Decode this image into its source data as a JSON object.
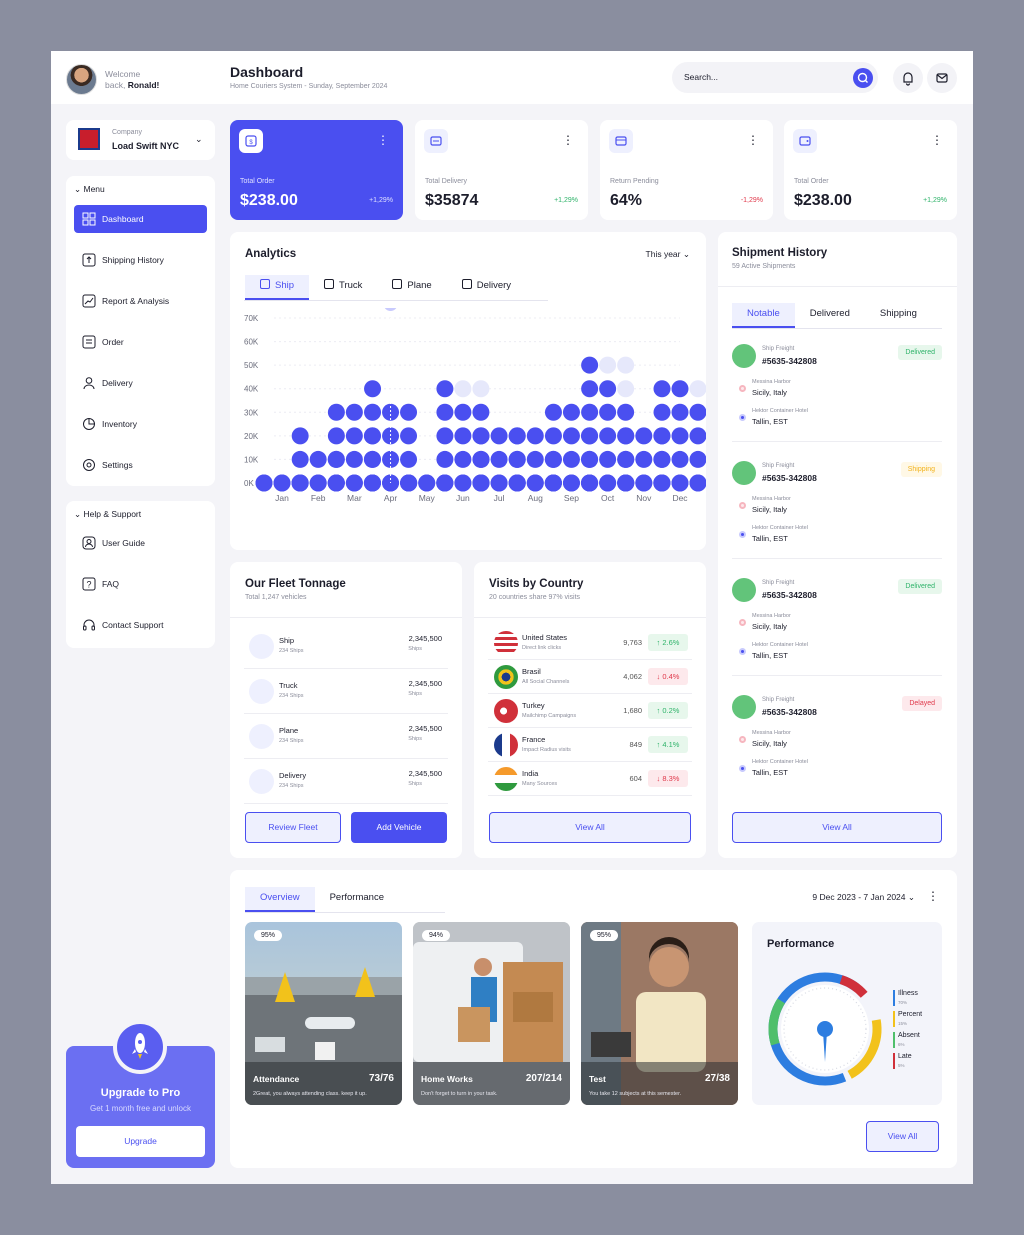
{
  "header": {
    "welcome": "Welcome",
    "welcome_back": "back,",
    "user_name": "Ronald!",
    "title": "Dashboard",
    "subtitle": "Home Couriers System - Sunday, September 2024",
    "search_placeholder": "Search..."
  },
  "company": {
    "label": "Company",
    "name": "Load Swift NYC"
  },
  "menu": {
    "section": "Menu",
    "items": [
      {
        "label": "Dashboard",
        "icon": "grid-icon"
      },
      {
        "label": "Shipping History",
        "icon": "upload-box-icon"
      },
      {
        "label": "Report & Analysis",
        "icon": "chart-icon"
      },
      {
        "label": "Order",
        "icon": "order-icon"
      },
      {
        "label": "Delivery",
        "icon": "user-icon"
      },
      {
        "label": "Inventory",
        "icon": "pie-icon"
      },
      {
        "label": "Settings",
        "icon": "gear-icon"
      }
    ]
  },
  "help": {
    "section": "Help & Support",
    "items": [
      {
        "label": "User Guide",
        "icon": "user-guide-icon"
      },
      {
        "label": "FAQ",
        "icon": "question-icon"
      },
      {
        "label": "Contact Support",
        "icon": "headset-icon"
      }
    ]
  },
  "upgrade": {
    "title": "Upgrade to Pro",
    "subtitle": "Get 1 month free and unlock",
    "button": "Upgrade"
  },
  "stats": [
    {
      "label": "Total Order",
      "value": "$238.00",
      "change": "+1,29%",
      "dir": "up"
    },
    {
      "label": "Total Delivery",
      "value": "$35874",
      "change": "+1,29%",
      "dir": "up"
    },
    {
      "label": "Return Pending",
      "value": "64%",
      "change": "-1,29%",
      "dir": "down"
    },
    {
      "label": "Total Order",
      "value": "$238.00",
      "change": "+1,29%",
      "dir": "up"
    }
  ],
  "analytics": {
    "title": "Analytics",
    "period": "This year",
    "tabs": [
      "Ship",
      "Truck",
      "Plane",
      "Delivery"
    ]
  },
  "chart_data": {
    "type": "bar",
    "title": "Analytics",
    "categories": [
      "Jan",
      "Feb",
      "Mar",
      "Apr",
      "May",
      "Jun",
      "Jul",
      "Aug",
      "Sep",
      "Oct",
      "Nov",
      "Dec"
    ],
    "yticks": [
      "0K",
      "10K",
      "20K",
      "30K",
      "40K",
      "50K",
      "60K",
      "70K"
    ],
    "ylim": [
      0,
      70
    ],
    "series": [
      {
        "values": [
          0,
          20,
          30,
          70,
          0,
          40,
          20,
          20,
          30,
          50,
          20,
          40
        ]
      },
      {
        "values": [
          0,
          10,
          30,
          30,
          0,
          30,
          20,
          20,
          30,
          40,
          30,
          40
        ]
      },
      {
        "values": [
          0,
          10,
          20,
          30,
          0,
          30,
          20,
          10,
          20,
          30,
          20,
          30
        ]
      }
    ],
    "background_levels": [
      0,
      20,
      45,
      45,
      0,
      50,
      35,
      35,
      45,
      60,
      25,
      50
    ],
    "highlight": {
      "category": "Apr",
      "value": 70
    },
    "colors": {
      "dot": "#4a4ff0",
      "muted": "#e6e8fb"
    }
  },
  "shipment": {
    "title": "Shipment History",
    "subtitle": "59 Active Shipments",
    "tabs": [
      "Notable",
      "Delivered",
      "Shipping"
    ],
    "items": [
      {
        "kind": "Ship Freight",
        "code": "#5635-342808",
        "status": "Delivered",
        "from_label": "Messina Harbor",
        "from": "Sicily, Italy",
        "to_label": "Hektor Container Hotel",
        "to": "Tallin, EST"
      },
      {
        "kind": "Ship Freight",
        "code": "#5635-342808",
        "status": "Shipping",
        "from_label": "Messina Harbor",
        "from": "Sicily, Italy",
        "to_label": "Hektor Container Hotel",
        "to": "Tallin, EST"
      },
      {
        "kind": "Ship Freight",
        "code": "#5635-342808",
        "status": "Delivered",
        "from_label": "Messina Harbor",
        "from": "Sicily, Italy",
        "to_label": "Hektor Container Hotel",
        "to": "Tallin, EST"
      },
      {
        "kind": "Ship Freight",
        "code": "#5635-342808",
        "status": "Delayed",
        "from_label": "Messina Harbor",
        "from": "Sicily, Italy",
        "to_label": "Hektor Container Hotel",
        "to": "Tallin, EST"
      }
    ],
    "view_all": "View All"
  },
  "fleet": {
    "title": "Our Fleet Tonnage",
    "subtitle": "Total 1,247 vehicles",
    "rows": [
      {
        "name": "Ship",
        "count": "234 Ships",
        "value": "2,345,500",
        "unit": "Ships"
      },
      {
        "name": "Truck",
        "count": "234 Ships",
        "value": "2,345,500",
        "unit": "Ships"
      },
      {
        "name": "Plane",
        "count": "234 Ships",
        "value": "2,345,500",
        "unit": "Ships"
      },
      {
        "name": "Delivery",
        "count": "234 Ships",
        "value": "2,345,500",
        "unit": "Ships"
      }
    ],
    "review": "Review Fleet",
    "add": "Add Vehicle"
  },
  "visits": {
    "title": "Visits by Country",
    "subtitle": "20 countries share 97% visits",
    "rows": [
      {
        "country": "United States",
        "source": "Direct link clicks",
        "visits": "9,763",
        "change": "↑ 2.6%",
        "dir": "up"
      },
      {
        "country": "Brasil",
        "source": "All Social Channels",
        "visits": "4,062",
        "change": "↓ 0.4%",
        "dir": "down"
      },
      {
        "country": "Turkey",
        "source": "Mailchimp Campaigns",
        "visits": "1,680",
        "change": "↑ 0.2%",
        "dir": "up"
      },
      {
        "country": "France",
        "source": "Impact Radius visits",
        "visits": "849",
        "change": "↑ 4.1%",
        "dir": "up"
      },
      {
        "country": "India",
        "source": "Many Sources",
        "visits": "604",
        "change": "↓ 8.3%",
        "dir": "down"
      }
    ],
    "view_all": "View All"
  },
  "overview": {
    "tabs": [
      "Overview",
      "Performance"
    ],
    "date_range": "9 Dec 2023 - 7 Jan 2024",
    "cards": [
      {
        "pct": "95%",
        "title": "Attendance",
        "score": "73/76",
        "desc": "2Great, you always attending class. keep it up."
      },
      {
        "pct": "94%",
        "title": "Home Works",
        "score": "207/214",
        "desc": "Don't forget to turn in your task."
      },
      {
        "pct": "95%",
        "title": "Test",
        "score": "27/38",
        "desc": "You take 12 subjects at this semester."
      }
    ],
    "performance": {
      "title": "Performance",
      "legend": [
        {
          "name": "Illness",
          "pct": "70%",
          "color": "#2d7de0"
        },
        {
          "name": "Percent",
          "pct": "15%",
          "color": "#f2c21b"
        },
        {
          "name": "Absent",
          "pct": "6%",
          "color": "#4fbf6b"
        },
        {
          "name": "Late",
          "pct": "5%",
          "color": "#d0303a"
        }
      ]
    },
    "view_all": "View All"
  }
}
